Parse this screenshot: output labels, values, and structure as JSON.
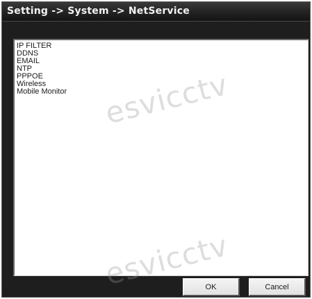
{
  "window": {
    "title": "Setting -> System -> NetService"
  },
  "service_list": {
    "items": [
      "IP FILTER",
      "DDNS",
      "EMAIL",
      "NTP",
      "PPPOE",
      "Wireless",
      "Mobile Monitor"
    ]
  },
  "buttons": {
    "ok_label": "OK",
    "cancel_label": "Cancel"
  },
  "watermark": {
    "text": "esvicctv"
  },
  "colors": {
    "window_background": "#1e1e1e",
    "title_text": "#f2f2f2",
    "list_background": "#ffffff",
    "button_face": "#e6e6e6"
  }
}
